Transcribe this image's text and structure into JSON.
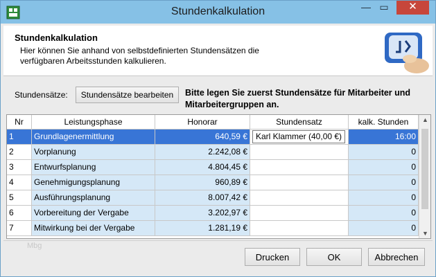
{
  "window": {
    "title": "Stundenkalkulation"
  },
  "titlebar_buttons": {
    "minimize": "—",
    "maximize": "▭",
    "close": "✕"
  },
  "header": {
    "title": "Stundenkalkulation",
    "description": "Hier können Sie anhand von selbstdefinierten Stundensätzen die verfügbaren Arbeitsstunden kalkulieren."
  },
  "rates": {
    "label": "Stundensätze:",
    "button": "Stundensätze bearbeiten",
    "hint": "Bitte legen Sie zuerst Stundensätze für Mitarbeiter und Mitarbeitergruppen an."
  },
  "table": {
    "columns": {
      "nr": "Nr",
      "phase": "Leistungsphase",
      "fee": "Honorar",
      "rate": "Stundensatz",
      "hours": "kalk. Stunden"
    },
    "rows": [
      {
        "nr": "1",
        "phase": "Grundlagenermittlung",
        "fee": "640,59 €",
        "rate": "Karl Klammer (40,00 €)",
        "hours": "16:00",
        "selected": true
      },
      {
        "nr": "2",
        "phase": "Vorplanung",
        "fee": "2.242,08 €",
        "rate": "",
        "hours": "0"
      },
      {
        "nr": "3",
        "phase": "Entwurfsplanung",
        "fee": "4.804,45 €",
        "rate": "",
        "hours": "0"
      },
      {
        "nr": "4",
        "phase": "Genehmigungsplanung",
        "fee": "960,89 €",
        "rate": "",
        "hours": "0"
      },
      {
        "nr": "5",
        "phase": "Ausführungsplanung",
        "fee": "8.007,42 €",
        "rate": "",
        "hours": "0"
      },
      {
        "nr": "6",
        "phase": "Vorbereitung der Vergabe",
        "fee": "3.202,97 €",
        "rate": "",
        "hours": "0"
      },
      {
        "nr": "7",
        "phase": "Mitwirkung bei der Vergabe",
        "fee": "1.281,19 €",
        "rate": "",
        "hours": "0"
      }
    ]
  },
  "footer": {
    "ghost_text": "Mbg",
    "print": "Drucken",
    "ok": "OK",
    "cancel": "Abbrechen"
  },
  "colors": {
    "titlebar": "#86c1e6",
    "selection": "#3875d6",
    "cell_tint": "#d5e8f7",
    "close_button": "#c7463b"
  }
}
